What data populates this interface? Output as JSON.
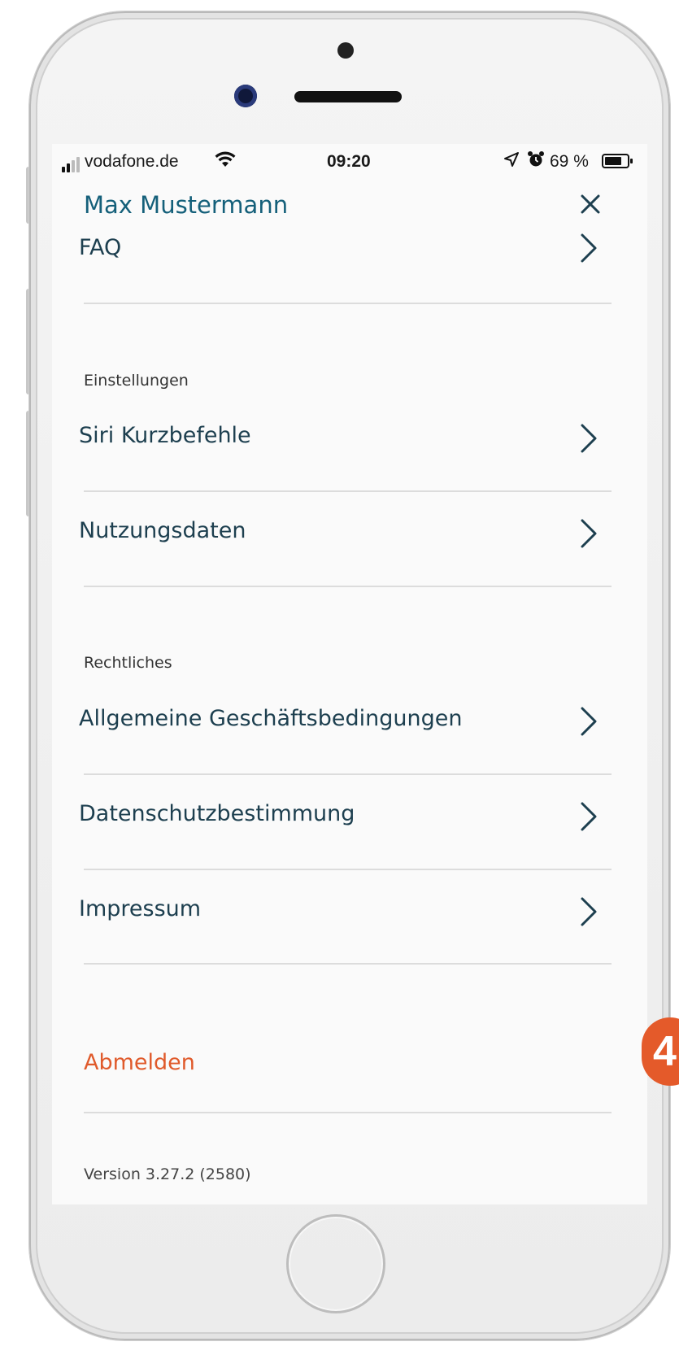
{
  "statusbar": {
    "carrier": "vodafone.de",
    "time": "09:20",
    "battery_percent": "69 %",
    "icons": [
      "signal-icon",
      "wifi-icon",
      "location-arrow-icon",
      "alarm-icon",
      "battery-icon"
    ]
  },
  "header": {
    "name": "Max Mustermann",
    "close_icon": "close-icon"
  },
  "menu": {
    "faq": "FAQ",
    "sections": [
      {
        "title": "Einstellungen",
        "items": [
          {
            "label": "Siri Kurzbefehle"
          },
          {
            "label": "Nutzungsdaten"
          }
        ]
      },
      {
        "title": "Rechtliches",
        "items": [
          {
            "label": "Allgemeine Geschäftsbedingungen"
          },
          {
            "label": "Datenschutzbestimmung"
          },
          {
            "label": "Impressum"
          }
        ]
      }
    ],
    "logout": "Abmelden",
    "version": "Version 3.27.2 (2580)"
  },
  "annotation": {
    "step_badge": "4"
  },
  "colors": {
    "name": "#15607a",
    "label": "#1d3f4f",
    "logout": "#e05a2b",
    "badge": "#e45a2a"
  }
}
